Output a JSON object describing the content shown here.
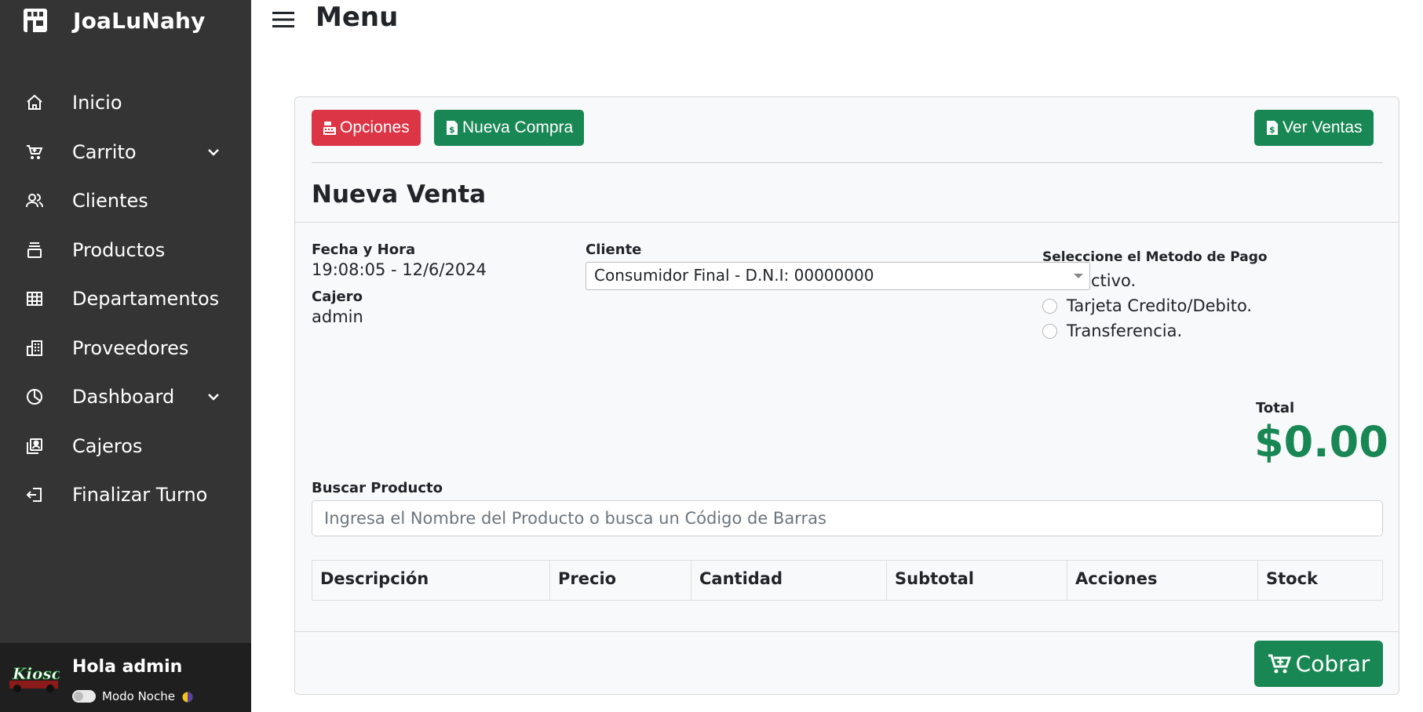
{
  "brand": {
    "name": "JoaLuNahy"
  },
  "sidebar": {
    "items": [
      {
        "label": "Inicio",
        "icon": "home-icon"
      },
      {
        "label": "Carrito",
        "icon": "cart-icon",
        "expandable": true
      },
      {
        "label": "Clientes",
        "icon": "users-icon"
      },
      {
        "label": "Productos",
        "icon": "products-icon"
      },
      {
        "label": "Departamentos",
        "icon": "grid-icon"
      },
      {
        "label": "Proveedores",
        "icon": "building-icon"
      },
      {
        "label": "Dashboard",
        "icon": "pie-chart-icon",
        "expandable": true
      },
      {
        "label": "Cajeros",
        "icon": "cashier-icon"
      },
      {
        "label": "Finalizar Turno",
        "icon": "logout-icon"
      }
    ],
    "user": {
      "hello": "Hola admin",
      "night_mode_label": "Modo Noche",
      "night_mode_on": false
    }
  },
  "header": {
    "title": "Menu"
  },
  "toolbar": {
    "opciones": "Opciones",
    "nueva_compra": "Nueva Compra",
    "ver_ventas": "Ver Ventas"
  },
  "venta": {
    "title": "Nueva Venta",
    "fecha_label": "Fecha y Hora",
    "fecha_value": "19:08:05 - 12/6/2024",
    "cajero_label": "Cajero",
    "cajero_value": "admin",
    "cliente_label": "Cliente",
    "cliente_value": "Consumidor Final - D.N.I: 00000000",
    "pago_label": "Seleccione el Metodo de Pago",
    "pago_options": [
      "Efectivo.",
      "Tarjeta Credito/Debito.",
      "Transferencia."
    ],
    "pago_visible_first": "ctivo.",
    "total_label": "Total",
    "total_value": "$0.00",
    "buscar_label": "Buscar Producto",
    "buscar_placeholder": "Ingresa el Nombre del Producto o busca un Código de Barras",
    "table_headers": [
      "Descripción",
      "Precio",
      "Cantidad",
      "Subtotal",
      "Acciones",
      "Stock"
    ],
    "cobrar": "Cobrar"
  },
  "colors": {
    "sidebar_bg": "#343434",
    "red": "#dc3545",
    "green": "#198754"
  }
}
